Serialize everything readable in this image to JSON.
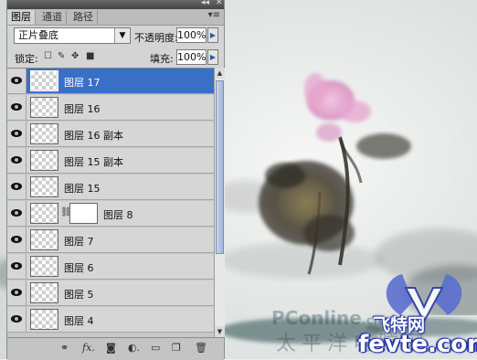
{
  "panel": {
    "tabs": [
      {
        "label": "图层",
        "active": true
      },
      {
        "label": "通道",
        "active": false
      },
      {
        "label": "路径",
        "active": false
      }
    ],
    "blend_mode": "正片叠底",
    "opacity_label": "不透明度:",
    "opacity_value": "100%",
    "lock_label": "锁定:",
    "fill_label": "填充:",
    "fill_value": "100%",
    "layers": [
      {
        "name": "图层 17",
        "selected": true,
        "visible": true,
        "has_mask": false
      },
      {
        "name": "图层 16",
        "selected": false,
        "visible": true,
        "has_mask": false
      },
      {
        "name": "图层 16 副本",
        "selected": false,
        "visible": true,
        "has_mask": false
      },
      {
        "name": "图层 15 副本",
        "selected": false,
        "visible": true,
        "has_mask": false
      },
      {
        "name": "图层 15",
        "selected": false,
        "visible": true,
        "has_mask": false
      },
      {
        "name": "图层 8",
        "selected": false,
        "visible": true,
        "has_mask": true
      },
      {
        "name": "图层 7",
        "selected": false,
        "visible": true,
        "has_mask": false
      },
      {
        "name": "图层 6",
        "selected": false,
        "visible": true,
        "has_mask": false
      },
      {
        "name": "图层 5",
        "selected": false,
        "visible": true,
        "has_mask": false
      },
      {
        "name": "图层 4",
        "selected": false,
        "visible": true,
        "has_mask": false
      }
    ],
    "footer_icons": [
      "link-icon",
      "fx-icon",
      "mask-icon",
      "adjustment-icon",
      "group-icon",
      "new-layer-icon",
      "trash-icon"
    ]
  },
  "watermarks": {
    "pconline": "PConline",
    "pconline_suffix": ".cn",
    "taiping": "太平洋电脑网",
    "feite": "飞特网",
    "fevte": "fevte.com"
  },
  "colors": {
    "selection": "#3a6fc8",
    "lotus_pink": "#e7a8d0",
    "ink_dark": "#2e2a20"
  }
}
